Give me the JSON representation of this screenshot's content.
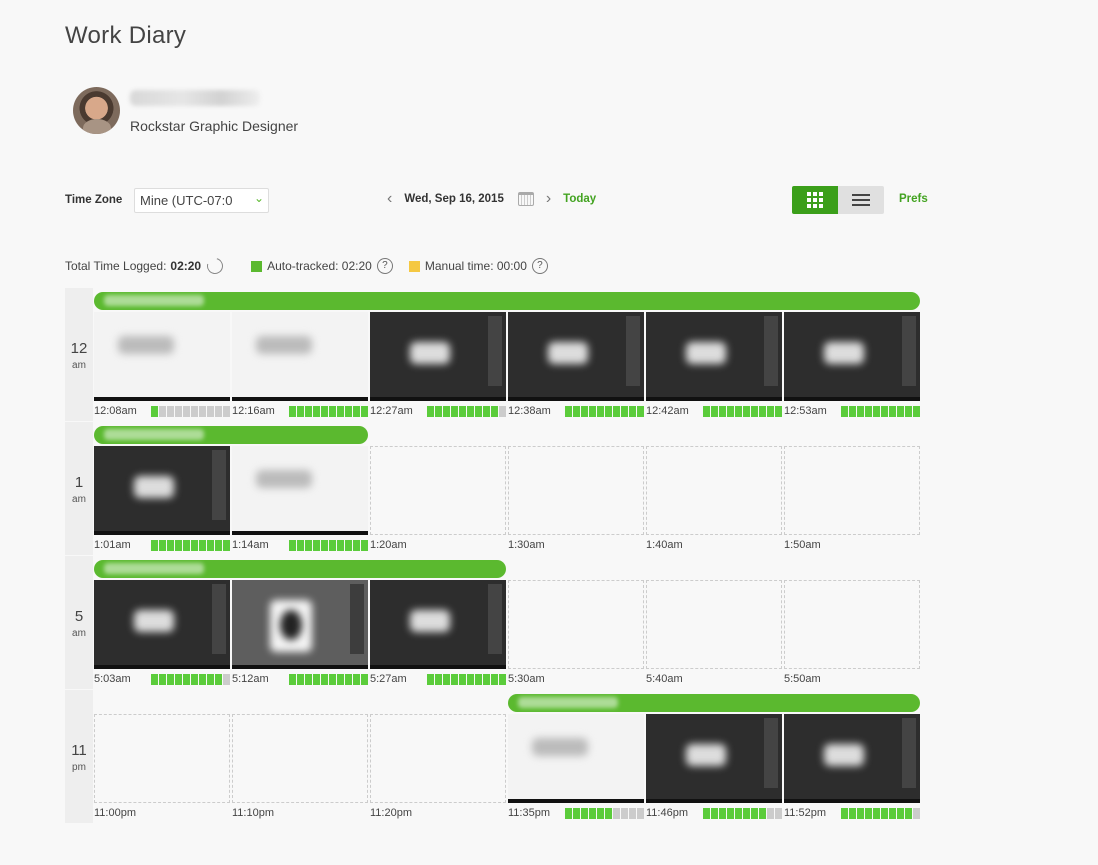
{
  "page": {
    "title": "Work Diary"
  },
  "profile": {
    "name": "admin user (blurred)",
    "role": "Rockstar Graphic Designer"
  },
  "controls": {
    "timezone_label": "Time Zone",
    "timezone_value": "Mine (UTC-07:0",
    "date": "Wed, Sep 16, 2015",
    "prev_icon": "chevron-left-icon",
    "next_icon": "chevron-right-icon",
    "calendar_icon": "calendar-icon",
    "today_label": "Today",
    "view_modes": [
      "grid",
      "list"
    ],
    "active_view": "grid",
    "prefs_label": "Prefs"
  },
  "totals": {
    "total_label": "Total Time Logged:",
    "total_value": "02:20",
    "auto_label": "Auto-tracked: 02:20",
    "manual_label": "Manual time: 00:00",
    "colors": {
      "auto": "#5bb92f",
      "manual": "#f5c842",
      "accent": "#43a321"
    }
  },
  "hours": [
    {
      "num": "12",
      "ampm": "am",
      "memo": {
        "text": "(blurred memo)",
        "start": 0,
        "span": 6
      },
      "slots": [
        {
          "time": "12:08am",
          "shot": "light",
          "activity": 1
        },
        {
          "time": "12:16am",
          "shot": "light",
          "activity": 10
        },
        {
          "time": "12:27am",
          "shot": "dark",
          "activity": 9
        },
        {
          "time": "12:38am",
          "shot": "dark",
          "activity": 10
        },
        {
          "time": "12:42am",
          "shot": "dark",
          "activity": 10
        },
        {
          "time": "12:53am",
          "shot": "dark",
          "activity": 10
        }
      ]
    },
    {
      "num": "1",
      "ampm": "am",
      "memo": {
        "text": "(blurred memo)",
        "start": 0,
        "span": 2
      },
      "slots": [
        {
          "time": "1:01am",
          "shot": "dark",
          "activity": 10
        },
        {
          "time": "1:14am",
          "shot": "light",
          "activity": 10
        },
        {
          "time": "1:20am",
          "shot": "empty",
          "activity": null
        },
        {
          "time": "1:30am",
          "shot": "empty",
          "activity": null
        },
        {
          "time": "1:40am",
          "shot": "empty",
          "activity": null
        },
        {
          "time": "1:50am",
          "shot": "empty",
          "activity": null
        }
      ]
    },
    {
      "num": "5",
      "ampm": "am",
      "memo": {
        "text": "(blurred memo)",
        "start": 0,
        "span": 3
      },
      "slots": [
        {
          "time": "5:03am",
          "shot": "dark",
          "activity": 9
        },
        {
          "time": "5:12am",
          "shot": "mid",
          "activity": 10
        },
        {
          "time": "5:27am",
          "shot": "dark",
          "activity": 10
        },
        {
          "time": "5:30am",
          "shot": "empty",
          "activity": null
        },
        {
          "time": "5:40am",
          "shot": "empty",
          "activity": null
        },
        {
          "time": "5:50am",
          "shot": "empty",
          "activity": null
        }
      ]
    },
    {
      "num": "11",
      "ampm": "pm",
      "memo": {
        "text": "(blurred memo)",
        "start": 3,
        "span": 3
      },
      "slots": [
        {
          "time": "11:00pm",
          "shot": "empty",
          "activity": null
        },
        {
          "time": "11:10pm",
          "shot": "empty",
          "activity": null
        },
        {
          "time": "11:20pm",
          "shot": "empty",
          "activity": null
        },
        {
          "time": "11:35pm",
          "shot": "light",
          "activity": 6
        },
        {
          "time": "11:46pm",
          "shot": "dark",
          "activity": 8
        },
        {
          "time": "11:52pm",
          "shot": "dark",
          "activity": 9
        }
      ]
    }
  ]
}
